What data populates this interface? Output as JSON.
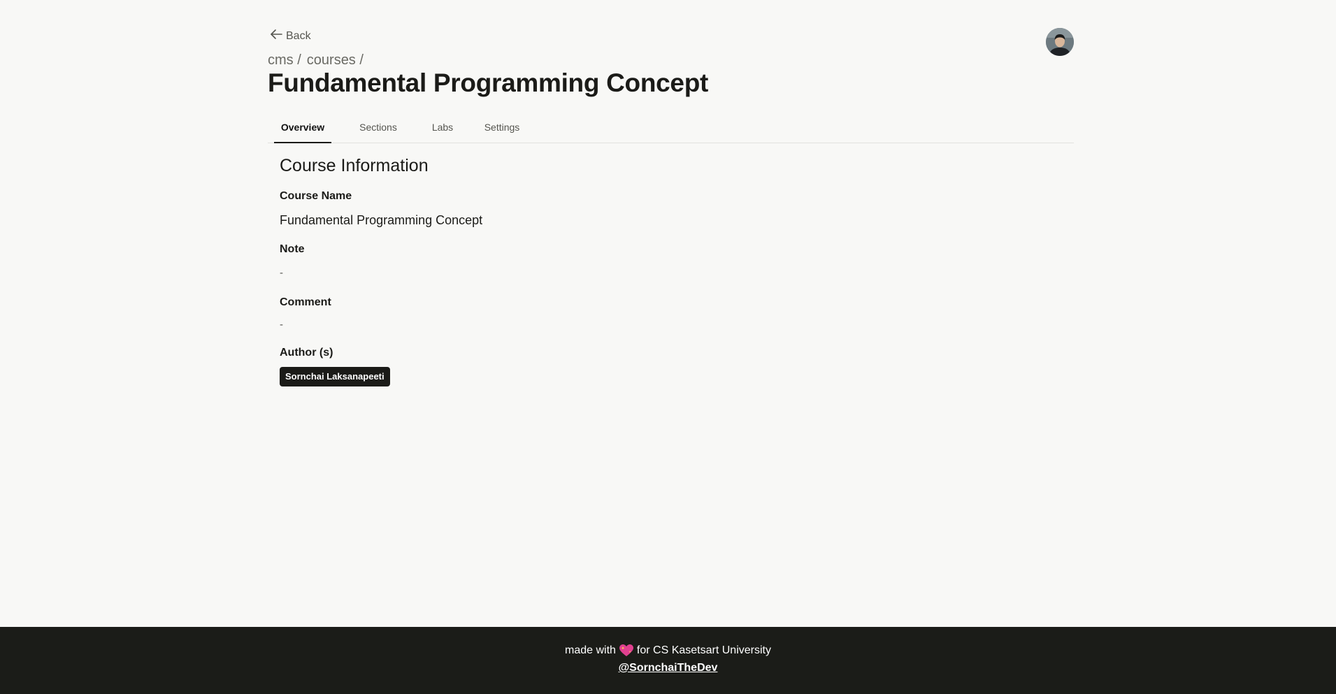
{
  "header": {
    "back_label": "Back",
    "breadcrumb": [
      "cms /",
      "courses /"
    ],
    "title": "Fundamental Programming Concept"
  },
  "tabs": [
    {
      "label": "Overview",
      "active": true
    },
    {
      "label": "Sections",
      "active": false
    },
    {
      "label": "Labs",
      "active": false
    },
    {
      "label": "Settings",
      "active": false
    }
  ],
  "course_info": {
    "section_title": "Course Information",
    "course_name_label": "Course Name",
    "course_name_value": "Fundamental Programming Concept",
    "note_label": "Note",
    "note_value": "-",
    "comment_label": "Comment",
    "comment_value": "-",
    "authors_label": "Author (s)",
    "authors": [
      "Sornchai Laksanapeeti"
    ]
  },
  "footer": {
    "made_with": "made with",
    "for_text": "for CS Kasetsart University",
    "link": "@SornchaiTheDev"
  },
  "colors": {
    "background": "#f8f8f6",
    "text": "#1b1b18",
    "footer_bg": "#1b1c18",
    "heart": "#e0408f"
  }
}
